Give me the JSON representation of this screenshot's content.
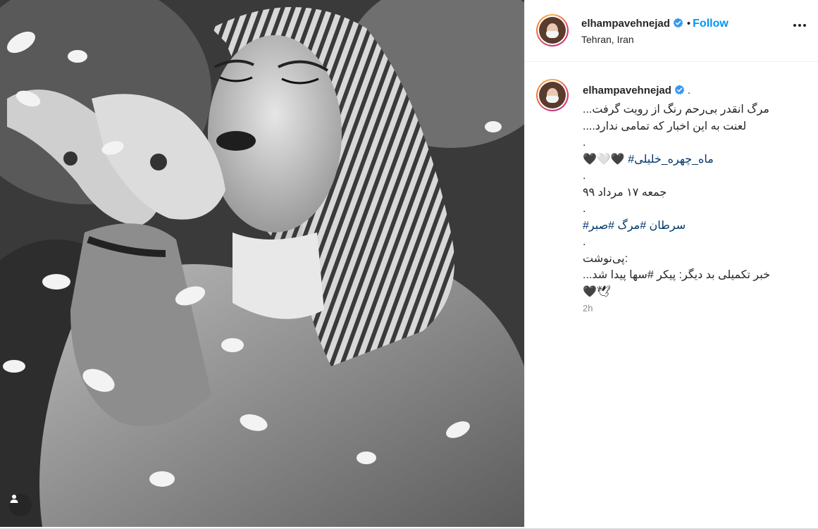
{
  "post": {
    "username": "elhampavehnejad",
    "follow_label": "Follow",
    "separator": "•",
    "location": "Tehran, Iran",
    "more_icon": "more-horizontal-icon",
    "verified_icon": "verified-badge-icon",
    "photo_alt": "Black and white photo of a woman in a striped headscarf blowing flower petals",
    "tag_icon": "user-tag-icon"
  },
  "caption": {
    "username": "elhampavehnejad",
    "suffix": ".",
    "lines": [
      "...مرگ انقدر بی‌رحم رنگ از رویت گرفت",
      "....لعنت به این اخبار که تمامی ندارد",
      ".",
      "#ماه_چهره_خلیلی",
      ".",
      "جمعه ۱۷ مرداد ۹۹",
      ".",
      "#سرطان #مرگ #صبر",
      ".",
      "پی‌نوشت:",
      "...خبر تکمیلی بد دیگر: پیکر #سها پیدا شد",
      "🖤🕊"
    ],
    "hearts": "🖤🤍🖤",
    "timestamp": "2h"
  },
  "colors": {
    "link": "#0095f6",
    "hashtag": "#00376b",
    "muted": "#8e8e8e",
    "text": "#262626"
  }
}
